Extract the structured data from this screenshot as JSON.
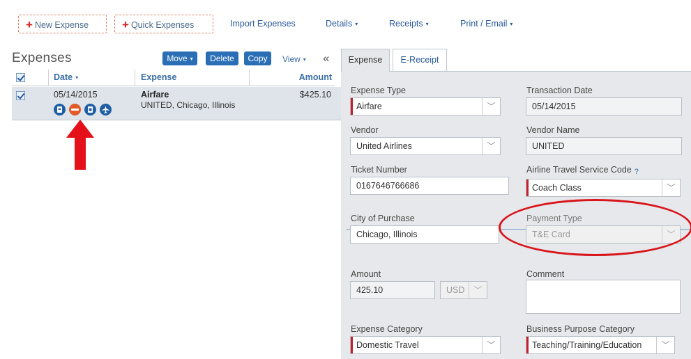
{
  "toolbar": {
    "new_expense": "New Expense",
    "quick_expenses": "Quick Expenses",
    "import_expenses": "Import Expenses",
    "details": "Details",
    "receipts": "Receipts",
    "print_email": "Print / Email",
    "caret": "▾"
  },
  "list": {
    "title": "Expenses",
    "move_label": "Move",
    "delete_label": "Delete",
    "copy_label": "Copy",
    "view_label": "View",
    "collapse_glyph": "«",
    "columns": {
      "date": "Date",
      "expense": "Expense",
      "amount": "Amount"
    },
    "rows": [
      {
        "date": "05/14/2015",
        "expense": "Airfare",
        "subtitle": "UNITED, Chicago, Illinois",
        "amount": "$425.10",
        "icons": [
          "receipt-icon",
          "exception-icon",
          "itemized-icon",
          "airfare-icon"
        ]
      }
    ]
  },
  "tabs": [
    {
      "label": "Expense",
      "active": true
    },
    {
      "label": "E-Receipt",
      "active": false
    }
  ],
  "form": {
    "expense_type": {
      "label": "Expense Type",
      "value": "Airfare"
    },
    "transaction_date": {
      "label": "Transaction Date",
      "value": "05/14/2015"
    },
    "vendor": {
      "label": "Vendor",
      "value": "United Airlines"
    },
    "vendor_name": {
      "label": "Vendor Name",
      "value": "UNITED"
    },
    "ticket_number": {
      "label": "Ticket Number",
      "value": "0167646766686"
    },
    "airline_service": {
      "label": "Airline Travel Service Code",
      "value": "Coach Class",
      "help": "?"
    },
    "city_of_purchase": {
      "label": "City of Purchase",
      "value": "Chicago, Illinois"
    },
    "payment_type": {
      "label": "Payment Type",
      "value": "T&E Card"
    },
    "amount": {
      "label": "Amount",
      "value": "425.10",
      "currency": "USD"
    },
    "comment": {
      "label": "Comment",
      "value": ""
    },
    "expense_category": {
      "label": "Expense Category",
      "value": "Domestic Travel"
    },
    "business_purpose": {
      "label": "Business Purpose Category",
      "value": "Teaching/Training/Education"
    }
  },
  "colors": {
    "accent_blue": "#2a6fb6",
    "required_red": "#c4202c",
    "annotation_red": "#d8151a"
  }
}
